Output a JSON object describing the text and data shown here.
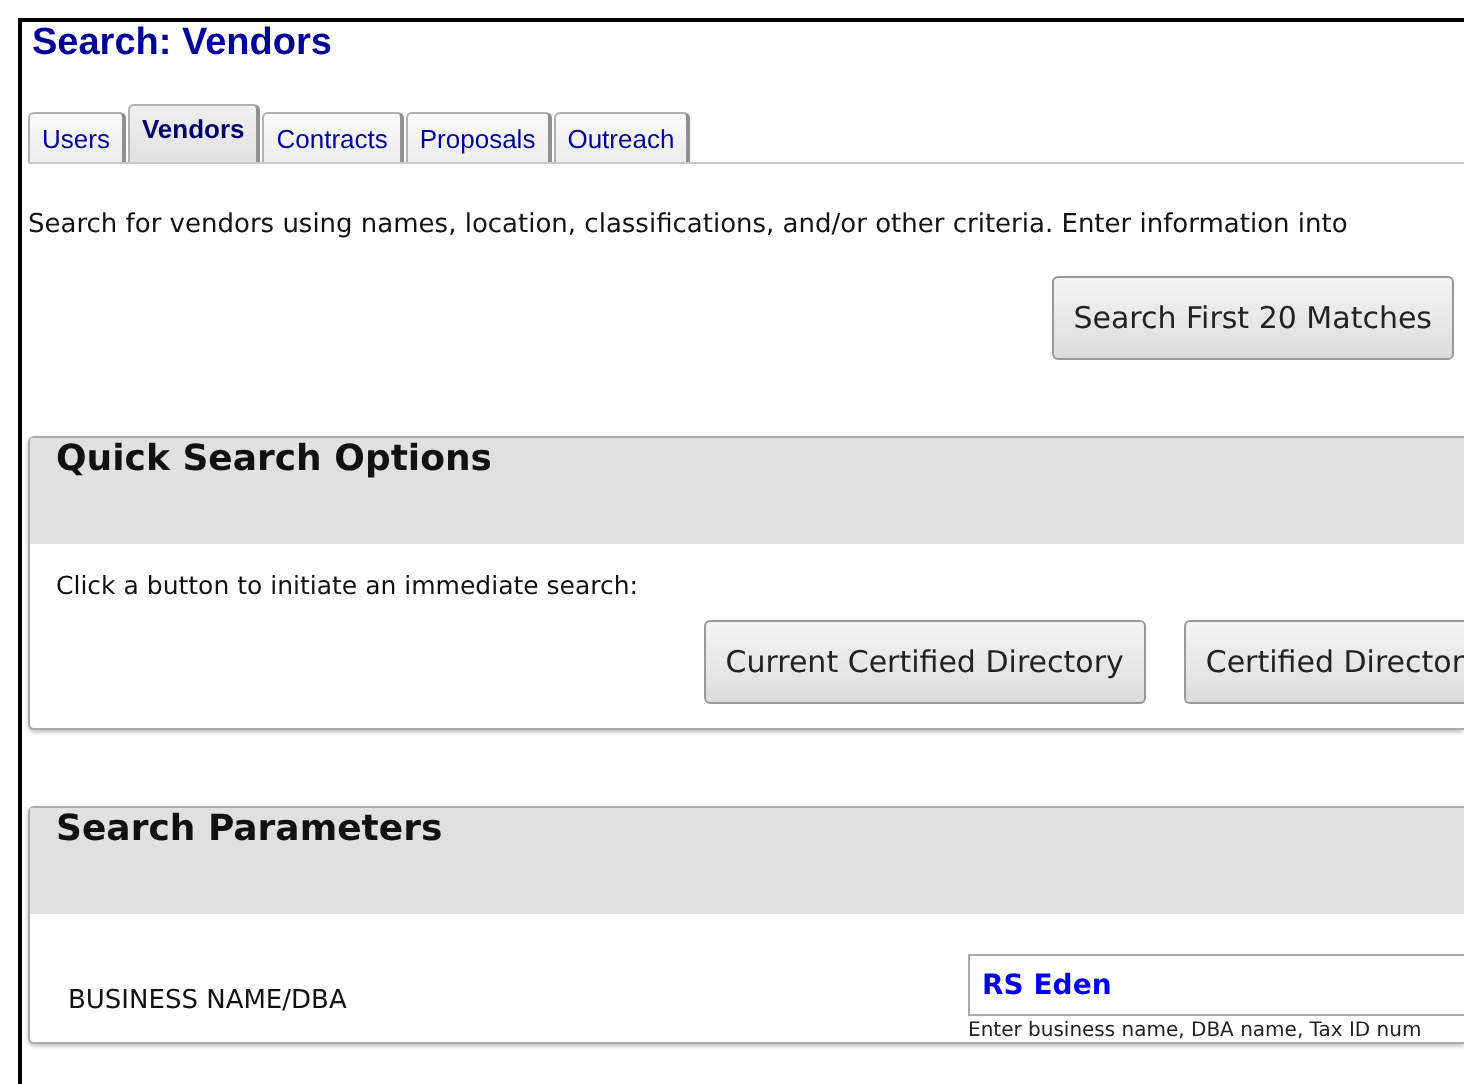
{
  "page_title": "Search: Vendors",
  "tabs": [
    {
      "label": "Users",
      "selected": false
    },
    {
      "label": "Vendors",
      "selected": true
    },
    {
      "label": "Contracts",
      "selected": false
    },
    {
      "label": "Proposals",
      "selected": false
    },
    {
      "label": "Outreach",
      "selected": false
    }
  ],
  "intro": "Search for vendors using names, location, classifications, and/or other criteria. Enter information into",
  "search_button": "Search First 20 Matches",
  "quick_search": {
    "title": "Quick Search Options",
    "instruction": "Click a button to initiate an immediate search:",
    "buttons": [
      "Current Certified Directory",
      "Certified Director"
    ]
  },
  "search_parameters": {
    "title": "Search Parameters",
    "fields": [
      {
        "label": "BUSINESS NAME/DBA",
        "value": "RS Eden",
        "hint": "Enter business name, DBA name, Tax ID num"
      }
    ]
  }
}
